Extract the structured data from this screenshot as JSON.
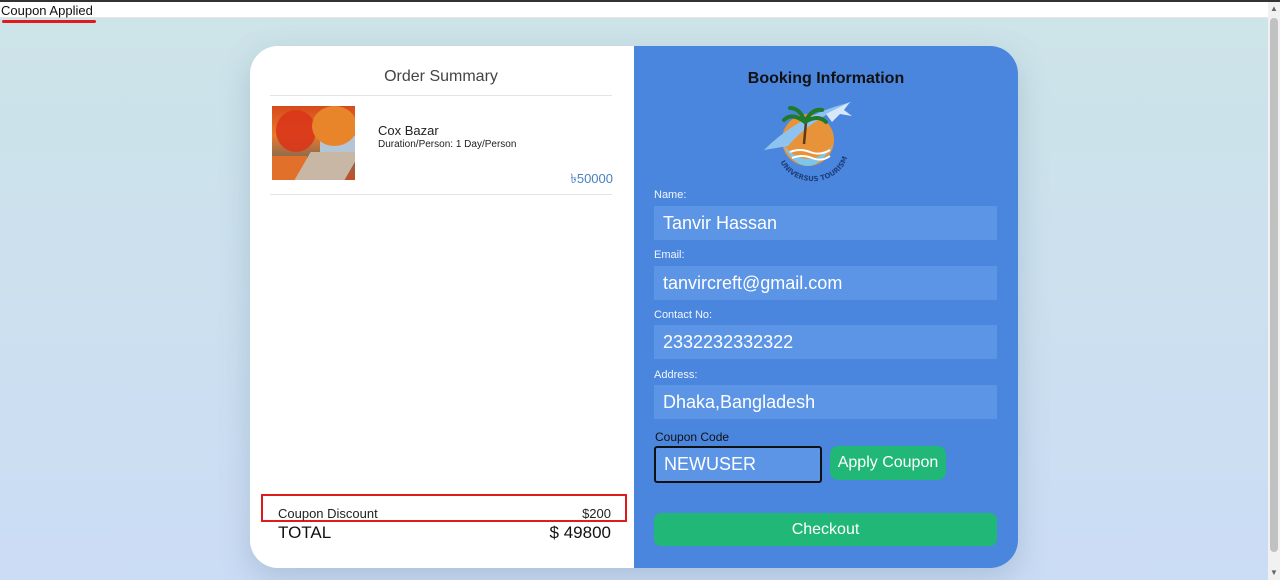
{
  "status": {
    "message": "Coupon Applied"
  },
  "order_summary": {
    "title": "Order Summary",
    "item": {
      "name": "Cox Bazar",
      "duration": "Duration/Person: 1 Day/Person",
      "price": "৳50000"
    },
    "coupon_discount_label": "Coupon Discount",
    "coupon_discount_value": "$200",
    "total_label": "TOTAL",
    "total_value": "$ 49800"
  },
  "booking": {
    "title": "Booking Information",
    "logo_text": "UNIVERSUS TOURISM",
    "fields": {
      "name_label": "Name:",
      "name_value": "Tanvir Hassan",
      "email_label": "Email:",
      "email_value": "tanvircreft@gmail.com",
      "contact_label": "Contact No:",
      "contact_value": "2332232332322",
      "address_label": "Address:",
      "address_value": "Dhaka,Bangladesh"
    },
    "coupon": {
      "label": "Coupon Code",
      "value": "NEWUSER",
      "apply_label": "Apply Coupon"
    },
    "checkout_label": "Checkout"
  },
  "colors": {
    "panel_blue": "#4a86de",
    "input_blue": "#5c95e6",
    "button_green": "#21b877",
    "highlight_red": "#e01b1b",
    "price_blue": "#4a7fc1"
  },
  "icons": [
    "logo-icon",
    "thumbnail-image"
  ]
}
